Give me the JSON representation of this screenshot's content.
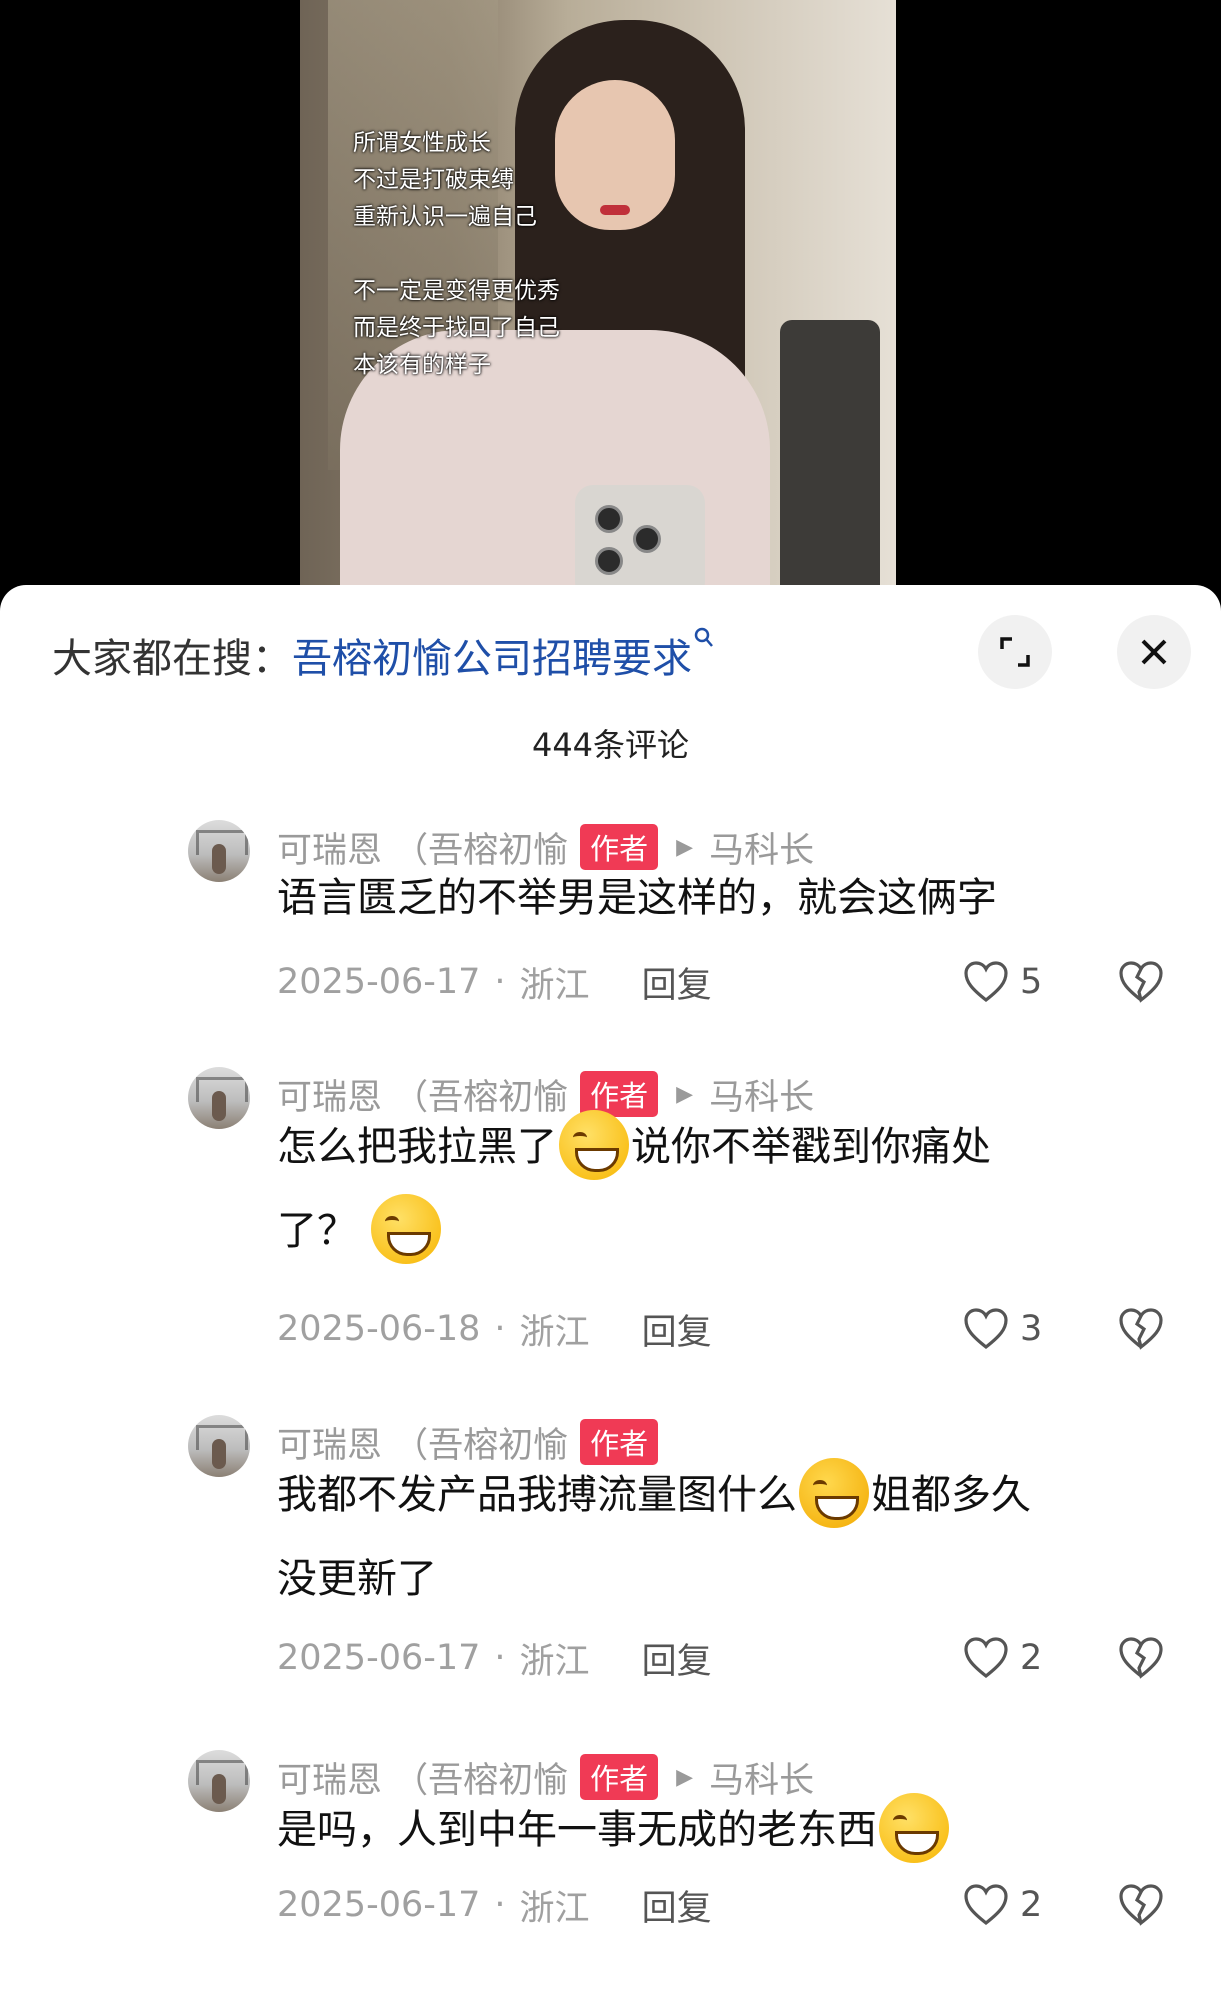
{
  "video": {
    "overlay_lines": [
      "所谓女性成长",
      "不过是打破束缚",
      "重新认识一遍自己",
      "",
      "不一定是变得更优秀",
      "而是终于找回了自己",
      "本该有的样子"
    ]
  },
  "search": {
    "label": "大家都在搜：",
    "term": "吾榕初愉公司招聘要求",
    "term_icon": "search-icon"
  },
  "comments_count": "444条评论",
  "comments": [
    {
      "name": "可瑞恩 （吾榕初愉",
      "badge": "作者",
      "reply_to": "马科长",
      "line1": "语言匮乏的不举男是这样的，就会这俩字",
      "date": "2025-06-17",
      "region": "浙江",
      "reply_label": "回复",
      "likes": "5"
    },
    {
      "name": "可瑞恩 （吾榕初愉",
      "badge": "作者",
      "reply_to": "马科长",
      "line1a": "怎么把我拉黑了",
      "line1b": "说你不举戳到你痛处",
      "line2": "了？",
      "date": "2025-06-18",
      "region": "浙江",
      "reply_label": "回复",
      "likes": "3"
    },
    {
      "name": "可瑞恩 （吾榕初愉",
      "badge": "作者",
      "line1a": "我都不发产品我搏流量图什么",
      "line1b": "姐都多久",
      "line2": "没更新了",
      "date": "2025-06-17",
      "region": "浙江",
      "reply_label": "回复",
      "likes": "2"
    },
    {
      "name": "可瑞恩 （吾榕初愉",
      "badge": "作者",
      "reply_to": "马科长",
      "line1": "是吗，人到中年一事无成的老东西",
      "date": "2025-06-17",
      "region": "浙江",
      "reply_label": "回复",
      "likes": "2"
    }
  ],
  "separator": "·",
  "icons": {
    "expand": "expand-icon",
    "close": "close-icon",
    "like": "heart-icon",
    "dislike": "broken-heart-icon",
    "grin": "grinning-emoji",
    "party": "partying-face-emoji"
  },
  "colors": {
    "badge": "#f03a55",
    "search_term": "#1f4fa8"
  }
}
